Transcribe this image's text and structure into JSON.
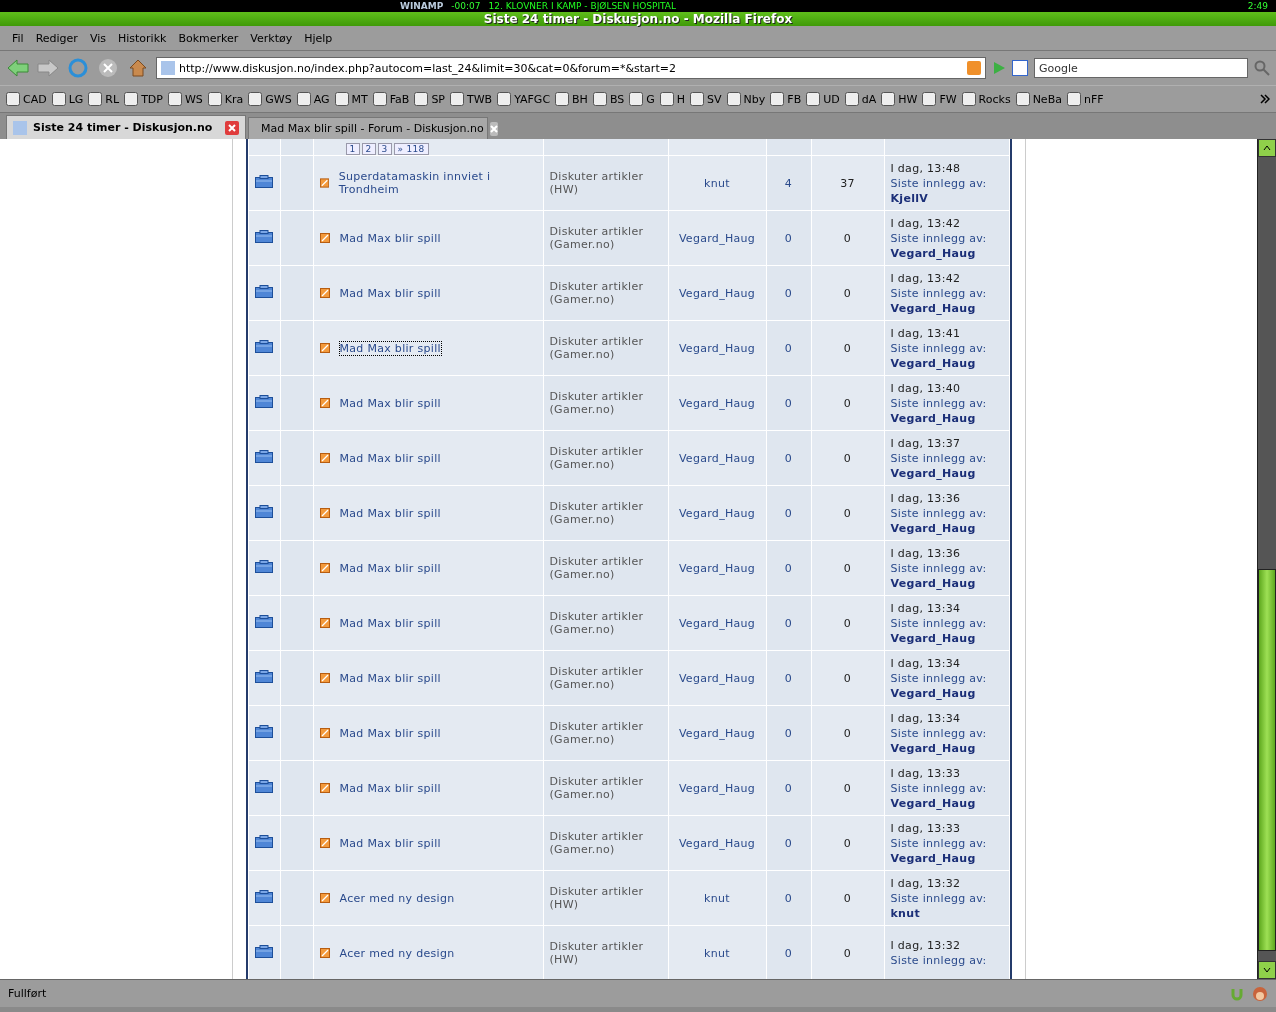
{
  "winamp": {
    "label": "WINAMP",
    "time_remaining": "-00:07",
    "track": "12. KLOVNER I KAMP - BJØLSEN HOSPITAL",
    "clock": "2:49"
  },
  "window": {
    "title": "Siste 24 timer - Diskusjon.no - Mozilla Firefox"
  },
  "menu": [
    "Fil",
    "Rediger",
    "Vis",
    "Historikk",
    "Bokmerker",
    "Verktøy",
    "Hjelp"
  ],
  "address": {
    "value": "http://www.diskusjon.no/index.php?autocom=last_24&limit=30&cat=0&forum=*&start=2"
  },
  "search": {
    "placeholder": "Google"
  },
  "bookmarks": [
    "CAD",
    "LG",
    "RL",
    "TDP",
    "WS",
    "Kra",
    "GWS",
    "AG",
    "MT",
    "FaB",
    "SP",
    "TWB",
    "YAFGC",
    "BH",
    "BS",
    "G",
    "H",
    "SV",
    "Nby",
    "FB",
    "UD",
    "dA",
    "HW",
    "FW",
    "Rocks",
    "NeBa",
    "nFF"
  ],
  "tabs": [
    {
      "label": "Siste 24 timer - Diskusjon.no",
      "selected": true
    },
    {
      "label": "Mad Max blir spill - Forum - Diskusjon.no",
      "selected": false
    }
  ],
  "partial_row": {
    "pages": [
      "1",
      "2",
      "3",
      "» 118"
    ]
  },
  "rows": [
    {
      "title": "Superdatamaskin innviet i Trondheim",
      "forum": "Diskuter artikler (HW)",
      "author": "knut",
      "replies": "4",
      "views": "37",
      "date": "I dag, 13:48",
      "last_label": "Siste innlegg av:",
      "last_author": "KjellV",
      "focused": false
    },
    {
      "title": "Mad Max blir spill",
      "forum": "Diskuter artikler (Gamer.no)",
      "author": "Vegard_Haug",
      "replies": "0",
      "views": "0",
      "date": "I dag, 13:42",
      "last_label": "Siste innlegg av:",
      "last_author": "Vegard_Haug",
      "focused": false
    },
    {
      "title": "Mad Max blir spill",
      "forum": "Diskuter artikler (Gamer.no)",
      "author": "Vegard_Haug",
      "replies": "0",
      "views": "0",
      "date": "I dag, 13:42",
      "last_label": "Siste innlegg av:",
      "last_author": "Vegard_Haug",
      "focused": false
    },
    {
      "title": "Mad Max blir spill",
      "forum": "Diskuter artikler (Gamer.no)",
      "author": "Vegard_Haug",
      "replies": "0",
      "views": "0",
      "date": "I dag, 13:41",
      "last_label": "Siste innlegg av:",
      "last_author": "Vegard_Haug",
      "focused": true
    },
    {
      "title": "Mad Max blir spill",
      "forum": "Diskuter artikler (Gamer.no)",
      "author": "Vegard_Haug",
      "replies": "0",
      "views": "0",
      "date": "I dag, 13:40",
      "last_label": "Siste innlegg av:",
      "last_author": "Vegard_Haug",
      "focused": false
    },
    {
      "title": "Mad Max blir spill",
      "forum": "Diskuter artikler (Gamer.no)",
      "author": "Vegard_Haug",
      "replies": "0",
      "views": "0",
      "date": "I dag, 13:37",
      "last_label": "Siste innlegg av:",
      "last_author": "Vegard_Haug",
      "focused": false
    },
    {
      "title": "Mad Max blir spill",
      "forum": "Diskuter artikler (Gamer.no)",
      "author": "Vegard_Haug",
      "replies": "0",
      "views": "0",
      "date": "I dag, 13:36",
      "last_label": "Siste innlegg av:",
      "last_author": "Vegard_Haug",
      "focused": false
    },
    {
      "title": "Mad Max blir spill",
      "forum": "Diskuter artikler (Gamer.no)",
      "author": "Vegard_Haug",
      "replies": "0",
      "views": "0",
      "date": "I dag, 13:36",
      "last_label": "Siste innlegg av:",
      "last_author": "Vegard_Haug",
      "focused": false
    },
    {
      "title": "Mad Max blir spill",
      "forum": "Diskuter artikler (Gamer.no)",
      "author": "Vegard_Haug",
      "replies": "0",
      "views": "0",
      "date": "I dag, 13:34",
      "last_label": "Siste innlegg av:",
      "last_author": "Vegard_Haug",
      "focused": false
    },
    {
      "title": "Mad Max blir spill",
      "forum": "Diskuter artikler (Gamer.no)",
      "author": "Vegard_Haug",
      "replies": "0",
      "views": "0",
      "date": "I dag, 13:34",
      "last_label": "Siste innlegg av:",
      "last_author": "Vegard_Haug",
      "focused": false
    },
    {
      "title": "Mad Max blir spill",
      "forum": "Diskuter artikler (Gamer.no)",
      "author": "Vegard_Haug",
      "replies": "0",
      "views": "0",
      "date": "I dag, 13:34",
      "last_label": "Siste innlegg av:",
      "last_author": "Vegard_Haug",
      "focused": false
    },
    {
      "title": "Mad Max blir spill",
      "forum": "Diskuter artikler (Gamer.no)",
      "author": "Vegard_Haug",
      "replies": "0",
      "views": "0",
      "date": "I dag, 13:33",
      "last_label": "Siste innlegg av:",
      "last_author": "Vegard_Haug",
      "focused": false
    },
    {
      "title": "Mad Max blir spill",
      "forum": "Diskuter artikler (Gamer.no)",
      "author": "Vegard_Haug",
      "replies": "0",
      "views": "0",
      "date": "I dag, 13:33",
      "last_label": "Siste innlegg av:",
      "last_author": "Vegard_Haug",
      "focused": false
    },
    {
      "title": "Acer med ny design",
      "forum": "Diskuter artikler (HW)",
      "author": "knut",
      "replies": "0",
      "views": "0",
      "date": "I dag, 13:32",
      "last_label": "Siste innlegg av:",
      "last_author": "knut",
      "focused": false
    },
    {
      "title": "Acer med ny design",
      "forum": "Diskuter artikler (HW)",
      "author": "knut",
      "replies": "0",
      "views": "0",
      "date": "I dag, 13:32",
      "last_label": "Siste innlegg av:",
      "focused": false
    }
  ],
  "status_bar": {
    "text": "Fullført"
  }
}
